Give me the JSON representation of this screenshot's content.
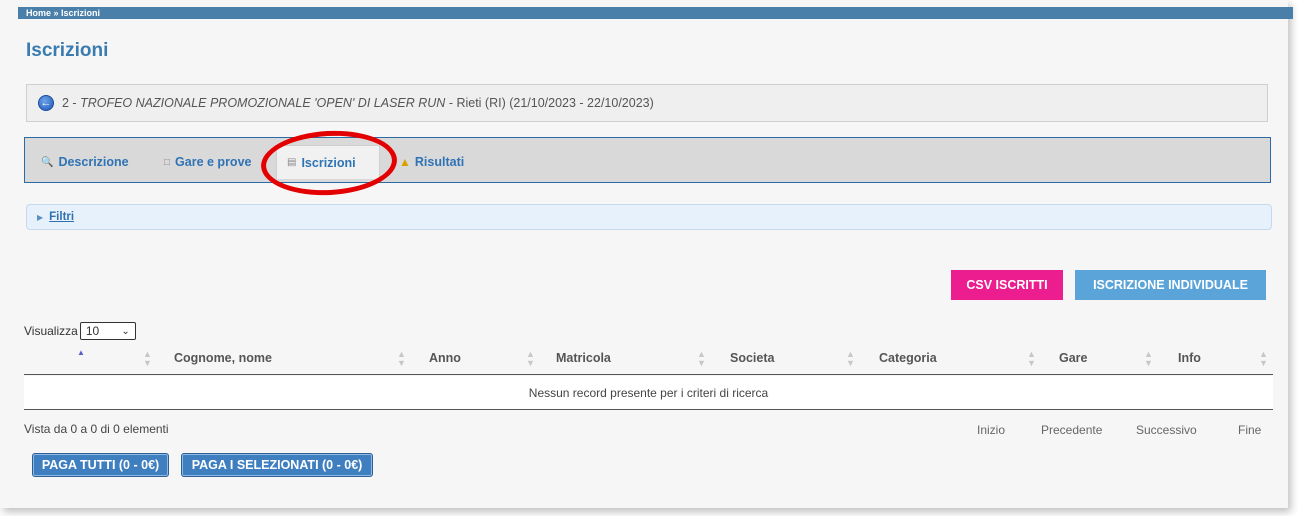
{
  "breadcrumb": "Home » Iscrizioni",
  "page_title": "Iscrizioni",
  "event": {
    "number": "2 -",
    "name": "TROFEO NAZIONALE PROMOZIONALE 'OPEN' DI LASER RUN",
    "location_dates": "- Rieti (RI) (21/10/2023 - 22/10/2023)"
  },
  "tabs": [
    {
      "label": "Descrizione",
      "icon": "magnifier-icon"
    },
    {
      "label": "Gare e prove",
      "icon": "book-icon"
    },
    {
      "label": "Iscrizioni",
      "icon": "document-icon"
    },
    {
      "label": "Risultati",
      "icon": "trophy-icon"
    }
  ],
  "filters_label": "Filtri",
  "buttons": {
    "csv": "CSV ISCRITTI",
    "individual": "ISCRIZIONE INDIVIDUALE",
    "pay_all": "PAGA TUTTI (0 - 0€)",
    "pay_selected": "PAGA I SELEZIONATI (0 - 0€)"
  },
  "page_size": {
    "label": "Visualizza",
    "value": "10"
  },
  "table": {
    "columns": [
      "Cognome, nome",
      "Anno",
      "Matricola",
      "Societa",
      "Categoria",
      "Gare",
      "Info"
    ],
    "empty_message": "Nessun record presente per i criteri di ricerca"
  },
  "info_text": "Vista da 0 a 0 di 0 elementi",
  "pagination": {
    "first": "Inizio",
    "previous": "Precedente",
    "next": "Successivo",
    "last": "Fine"
  },
  "colors": {
    "accent": "#3a7cb0",
    "csv_button": "#ec1d8e",
    "individual_button": "#5aa4da",
    "highlight": "#e30000"
  }
}
